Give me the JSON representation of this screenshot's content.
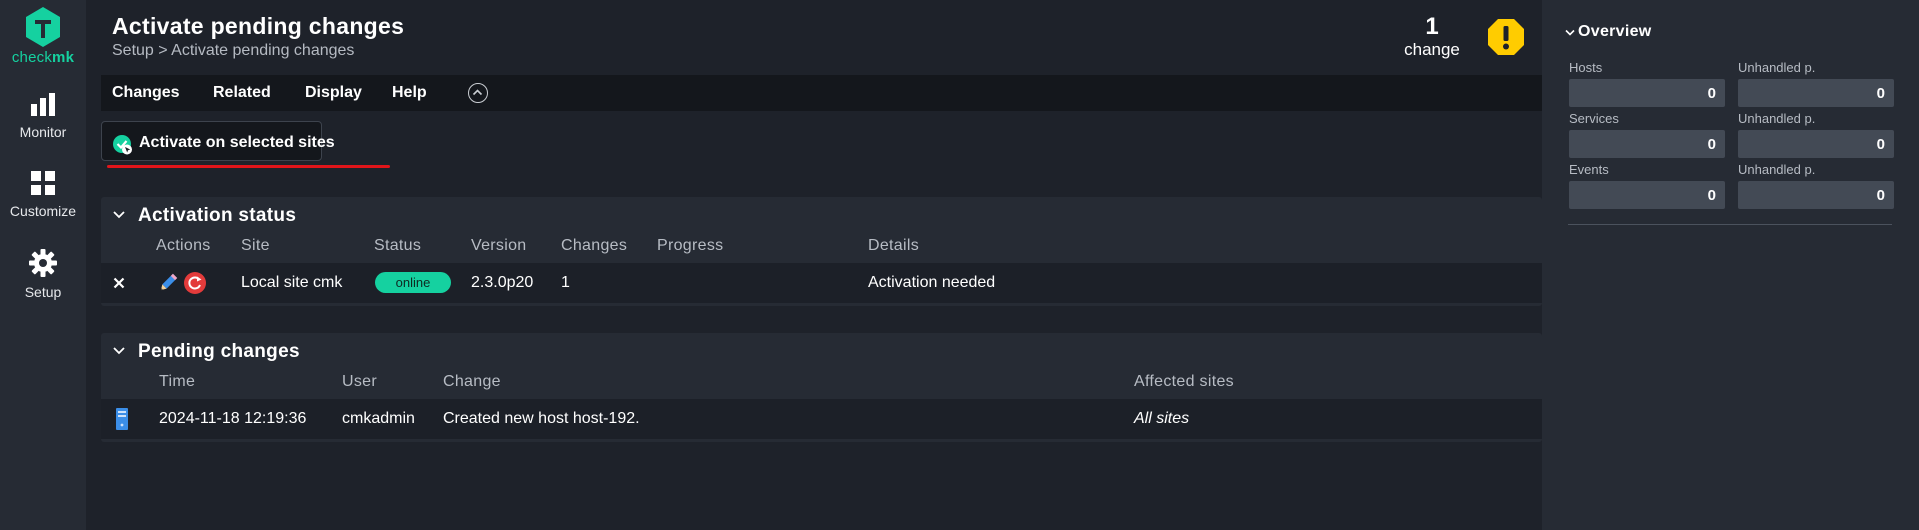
{
  "app": {
    "brand_left": "check",
    "brand_right": "mk"
  },
  "nav": {
    "items": [
      {
        "label": "Monitor",
        "icon": "bar-chart-icon"
      },
      {
        "label": "Customize",
        "icon": "grid-icon"
      },
      {
        "label": "Setup",
        "icon": "gear-icon"
      }
    ]
  },
  "header": {
    "title": "Activate pending changes",
    "breadcrumb": "Setup > Activate pending changes",
    "change_count": "1",
    "change_label": "change"
  },
  "menubar": {
    "items": [
      "Changes",
      "Related",
      "Display",
      "Help"
    ]
  },
  "actions": {
    "activate_label": "Activate on selected sites"
  },
  "activation_status": {
    "title": "Activation status",
    "columns": [
      "Actions",
      "Site",
      "Status",
      "Version",
      "Changes",
      "Progress",
      "Details"
    ],
    "rows": [
      {
        "site": "Local site cmk",
        "status": "online",
        "version": "2.3.0p20",
        "changes": "1",
        "progress": "",
        "details": "Activation needed"
      }
    ]
  },
  "pending_changes": {
    "title": "Pending changes",
    "columns": [
      "Time",
      "User",
      "Change",
      "Affected sites"
    ],
    "rows": [
      {
        "time": "2024-11-18 12:19:36",
        "user": "cmkadmin",
        "change": "Created new host host-192.",
        "affected_sites": "All sites"
      }
    ]
  },
  "overview": {
    "title": "Overview",
    "stats": [
      {
        "label": "Hosts",
        "value": "0",
        "unhandled_label": "Unhandled p.",
        "unhandled_value": "0"
      },
      {
        "label": "Services",
        "value": "0",
        "unhandled_label": "Unhandled p.",
        "unhandled_value": "0"
      },
      {
        "label": "Events",
        "value": "0",
        "unhandled_label": "Unhandled p.",
        "unhandled_value": "0"
      }
    ]
  },
  "colors": {
    "accent": "#15d1a0",
    "warning": "#ffcc00",
    "error": "#e33b3b",
    "highlight_underline": "#e0151a"
  }
}
